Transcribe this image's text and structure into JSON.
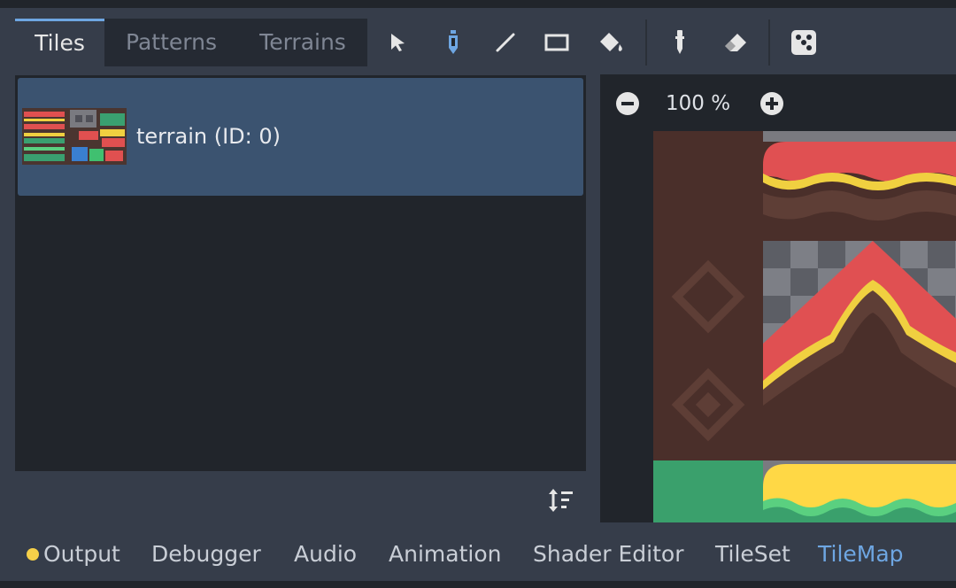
{
  "tabs": [
    {
      "label": "Tiles",
      "active": true
    },
    {
      "label": "Patterns",
      "active": false
    },
    {
      "label": "Terrains",
      "active": false
    }
  ],
  "toolbar": {
    "icons": [
      "select-icon",
      "paint-brush-icon",
      "line-icon",
      "rectangle-icon",
      "bucket-fill-icon",
      "picker-icon",
      "eraser-icon",
      "random-dice-icon"
    ],
    "active_tool": "paint-brush-icon"
  },
  "tile_list": {
    "items": [
      {
        "label": "terrain (ID: 0)",
        "selected": true
      }
    ]
  },
  "atlas_view": {
    "zoom_label": "100 %"
  },
  "bottom_panel": {
    "tabs": [
      {
        "label": "Output",
        "has_indicator": true
      },
      {
        "label": "Debugger"
      },
      {
        "label": "Audio"
      },
      {
        "label": "Animation"
      },
      {
        "label": "Shader Editor"
      },
      {
        "label": "TileSet"
      },
      {
        "label": "TileMap",
        "active": true
      }
    ]
  },
  "colors": {
    "accent": "#6ea6e2",
    "panel_bg": "#21252b",
    "editor_bg": "#363d4a",
    "selection": "#3b5370",
    "indicator": "#f6d049"
  }
}
